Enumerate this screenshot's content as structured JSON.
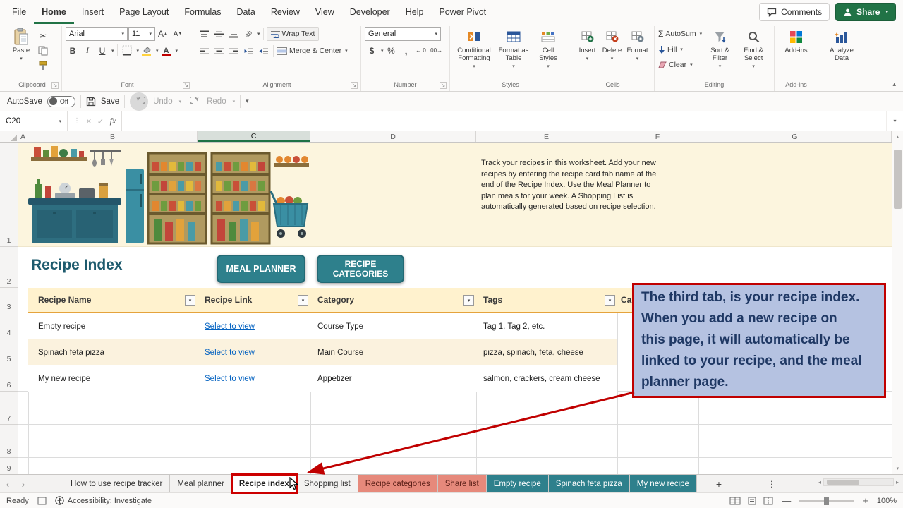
{
  "app": {
    "menu_tabs": [
      "File",
      "Home",
      "Insert",
      "Page Layout",
      "Formulas",
      "Data",
      "Review",
      "View",
      "Developer",
      "Help",
      "Power Pivot"
    ],
    "comments_label": "Comments",
    "share_label": "Share"
  },
  "ribbon": {
    "paste": "Paste",
    "clipboard_label": "Clipboard",
    "font_name": "Arial",
    "font_size": "11",
    "bold": "B",
    "italic": "I",
    "underline": "U",
    "font_label": "Font",
    "wrap_text": "Wrap Text",
    "merge_center": "Merge & Center",
    "alignment_label": "Alignment",
    "number_format": "General",
    "dollar": "$",
    "percent": "%",
    "comma": ",",
    "number_label": "Number",
    "conditional_formatting": "Conditional Formatting",
    "format_as_table": "Format as Table",
    "cell_styles": "Cell Styles",
    "styles_label": "Styles",
    "insert": "Insert",
    "delete": "Delete",
    "format": "Format",
    "cells_label": "Cells",
    "autosum": "AutoSum",
    "fill": "Fill",
    "clear": "Clear",
    "sort_filter": "Sort & Filter",
    "find_select": "Find & Select",
    "editing_label": "Editing",
    "addins": "Add-ins",
    "addins_label": "Add-ins",
    "analyze_data": "Analyze Data"
  },
  "qat": {
    "autosave": "AutoSave",
    "autosave_state": "Off",
    "save": "Save",
    "undo": "Undo",
    "redo": "Redo"
  },
  "formula_bar": {
    "cell_ref": "C20",
    "fx": "fx"
  },
  "grid": {
    "col_headers": [
      "A",
      "B",
      "C",
      "D",
      "E",
      "F",
      "G"
    ],
    "row_headers": [
      "1",
      "2",
      "3",
      "4",
      "5",
      "6",
      "7",
      "8",
      "9"
    ]
  },
  "content": {
    "intro": "Track your recipes in this worksheet. Add your new\nrecipes by entering the recipe card tab name at the\nend of the Recipe Index. Use the Meal Planner to\nplan meals for your week. A Shopping List is\nautomatically generated based on recipe selection.",
    "title": "Recipe Index",
    "meal_planner_btn": "MEAL PLANNER",
    "recipe_categories_btn": "RECIPE\nCATEGORIES",
    "table": {
      "col1": "Recipe Name",
      "col2": "Recipe Link",
      "col3": "Category",
      "col4": "Tags",
      "col5": "Ca",
      "rows": [
        {
          "name": "Empty recipe",
          "link": "Select to view",
          "category": "Course Type",
          "tags": "Tag 1, Tag 2, etc."
        },
        {
          "name": "Spinach feta pizza",
          "link": "Select to view",
          "category": "Main Course",
          "tags": "pizza, spinach, feta, cheese"
        },
        {
          "name": "My new recipe",
          "link": "Select to view",
          "category": "Appetizer",
          "tags": "salmon, crackers, cream cheese"
        }
      ]
    }
  },
  "callout": {
    "text": "The third tab, is your recipe index.\nWhen you add a new recipe on\nthis page, it will automatically be\nlinked to your recipe, and the meal\nplanner page."
  },
  "sheet_tabs": [
    {
      "label": "How to use recipe tracker",
      "color": ""
    },
    {
      "label": "Meal planner",
      "color": ""
    },
    {
      "label": "Recipe index",
      "color": "",
      "selected": true
    },
    {
      "label": "Shopping list",
      "color": ""
    },
    {
      "label": "Recipe categories",
      "color": "#E6897B"
    },
    {
      "label": "Share list",
      "color": "#E6897B"
    },
    {
      "label": "Empty recipe",
      "color": "#2E808C"
    },
    {
      "label": "Spinach feta pizza",
      "color": "#2E808C"
    },
    {
      "label": "My new recipe",
      "color": "#2E808C"
    }
  ],
  "status": {
    "ready": "Ready",
    "accessibility": "Accessibility: Investigate",
    "zoom": "100%"
  },
  "colors": {
    "excel_green": "#217346",
    "teal_button": "#2E808C",
    "callout_bg": "#B5C2E1",
    "callout_border": "#C00000",
    "link_blue": "#0563C1",
    "banner_bg": "#FCF5DE",
    "header_row_bg": "#FFF2CE",
    "band_row_bg": "#FBF2DE",
    "salmon_tab": "#E6897B"
  }
}
